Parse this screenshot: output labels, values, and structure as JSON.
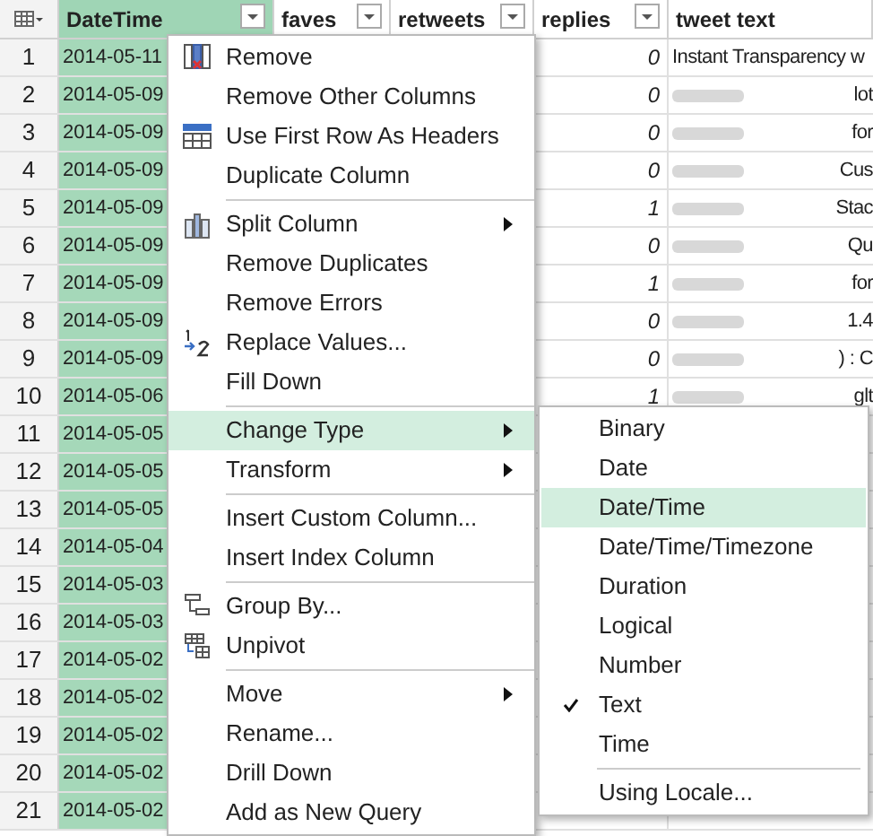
{
  "table": {
    "columns": [
      {
        "label": "DateTime",
        "selected": true,
        "filter": true
      },
      {
        "label": "faves",
        "selected": false,
        "filter": true
      },
      {
        "label": "retweets",
        "selected": false,
        "filter": true
      },
      {
        "label": "replies",
        "selected": false,
        "filter": true
      },
      {
        "label": "tweet text",
        "selected": false,
        "filter": false
      }
    ],
    "rows": [
      {
        "index": "1",
        "datetime": "2014-05-11",
        "replies": "0",
        "tweet_text": "Instant Transparency w",
        "redacted": false
      },
      {
        "index": "2",
        "datetime": "2014-05-09",
        "replies": "0",
        "tweet_text": "lot",
        "redacted": true
      },
      {
        "index": "3",
        "datetime": "2014-05-09",
        "replies": "0",
        "tweet_text": "for",
        "redacted": true
      },
      {
        "index": "4",
        "datetime": "2014-05-09",
        "replies": "0",
        "tweet_text": "Cus",
        "redacted": true
      },
      {
        "index": "5",
        "datetime": "2014-05-09",
        "replies": "1",
        "tweet_text": "Stac",
        "redacted": true
      },
      {
        "index": "6",
        "datetime": "2014-05-09",
        "replies": "0",
        "tweet_text": "Qu",
        "redacted": true
      },
      {
        "index": "7",
        "datetime": "2014-05-09",
        "replies": "1",
        "tweet_text": "for",
        "redacted": true
      },
      {
        "index": "8",
        "datetime": "2014-05-09",
        "replies": "0",
        "tweet_text": "1.4",
        "redacted": true
      },
      {
        "index": "9",
        "datetime": "2014-05-09",
        "replies": "0",
        "tweet_text": ") : C",
        "redacted": true
      },
      {
        "index": "10",
        "datetime": "2014-05-06",
        "replies": "1",
        "tweet_text": "glt",
        "redacted": true
      },
      {
        "index": "11",
        "datetime": "2014-05-05"
      },
      {
        "index": "12",
        "datetime": "2014-05-05"
      },
      {
        "index": "13",
        "datetime": "2014-05-05"
      },
      {
        "index": "14",
        "datetime": "2014-05-04"
      },
      {
        "index": "15",
        "datetime": "2014-05-03"
      },
      {
        "index": "16",
        "datetime": "2014-05-03"
      },
      {
        "index": "17",
        "datetime": "2014-05-02"
      },
      {
        "index": "18",
        "datetime": "2014-05-02"
      },
      {
        "index": "19",
        "datetime": "2014-05-02"
      },
      {
        "index": "20",
        "datetime": "2014-05-02"
      },
      {
        "index": "21",
        "datetime": "2014-05-02"
      }
    ]
  },
  "context_menu": {
    "groups": [
      [
        {
          "label": "Remove",
          "submenu": false,
          "selected": false
        },
        {
          "label": "Remove Other Columns",
          "submenu": false,
          "selected": false
        },
        {
          "label": "Use First Row As Headers",
          "submenu": false,
          "selected": false
        },
        {
          "label": "Duplicate Column",
          "submenu": false,
          "selected": false
        }
      ],
      [
        {
          "label": "Split Column",
          "submenu": true,
          "selected": false
        },
        {
          "label": "Remove Duplicates",
          "submenu": false,
          "selected": false
        },
        {
          "label": "Remove Errors",
          "submenu": false,
          "selected": false
        },
        {
          "label": "Replace Values...",
          "submenu": false,
          "selected": false
        },
        {
          "label": "Fill Down",
          "submenu": false,
          "selected": false
        }
      ],
      [
        {
          "label": "Change Type",
          "submenu": true,
          "selected": true
        },
        {
          "label": "Transform",
          "submenu": true,
          "selected": false
        }
      ],
      [
        {
          "label": "Insert Custom Column...",
          "submenu": false,
          "selected": false
        },
        {
          "label": "Insert Index Column",
          "submenu": false,
          "selected": false
        }
      ],
      [
        {
          "label": "Group By...",
          "submenu": false,
          "selected": false
        },
        {
          "label": "Unpivot",
          "submenu": false,
          "selected": false
        }
      ],
      [
        {
          "label": "Move",
          "submenu": true,
          "selected": false
        },
        {
          "label": "Rename...",
          "submenu": false,
          "selected": false
        },
        {
          "label": "Drill Down",
          "submenu": false,
          "selected": false
        },
        {
          "label": "Add as New Query",
          "submenu": false,
          "selected": false
        }
      ]
    ]
  },
  "type_submenu": {
    "groups": [
      [
        {
          "label": "Binary",
          "checked": false,
          "selected": false
        },
        {
          "label": "Date",
          "checked": false,
          "selected": false
        },
        {
          "label": "Date/Time",
          "checked": false,
          "selected": true
        },
        {
          "label": "Date/Time/Timezone",
          "checked": false,
          "selected": false
        },
        {
          "label": "Duration",
          "checked": false,
          "selected": false
        },
        {
          "label": "Logical",
          "checked": false,
          "selected": false
        },
        {
          "label": "Number",
          "checked": false,
          "selected": false
        },
        {
          "label": "Text",
          "checked": true,
          "selected": false
        },
        {
          "label": "Time",
          "checked": false,
          "selected": false
        }
      ],
      [
        {
          "label": "Using Locale...",
          "checked": false,
          "selected": false
        }
      ]
    ]
  }
}
